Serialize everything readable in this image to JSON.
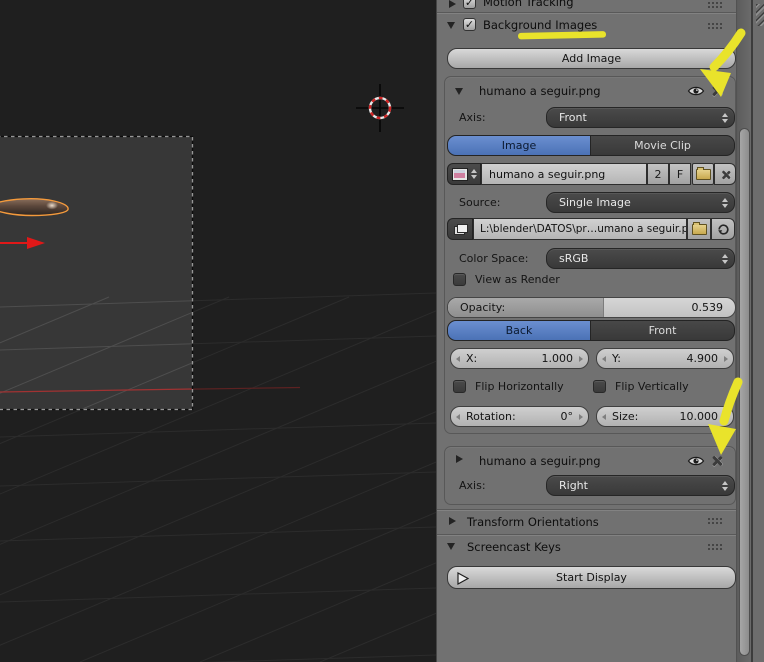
{
  "icons": {
    "checkmark": "✓"
  },
  "panel": {
    "motion_tracking": {
      "label": "Motion Tracking"
    },
    "background_images": {
      "label": "Background Images",
      "add_button": "Add Image"
    },
    "image1": {
      "title": "humano a seguir.png",
      "axis_label": "Axis:",
      "axis_value": "Front",
      "tab_image": "Image",
      "tab_movie_clip": "Movie Clip",
      "datablock_name": "humano a seguir.png",
      "users_count": "2",
      "fake_user": "F",
      "source_label": "Source:",
      "source_value": "Single Image",
      "filepath": "L:\\blender\\DATOS\\pr…umano a seguir.png",
      "color_space_label": "Color Space:",
      "color_space_value": "sRGB",
      "view_as_render_label": "View as Render",
      "opacity_label": "Opacity:",
      "opacity_value": "0.539",
      "back_label": "Back",
      "front_label": "Front",
      "x_label": "X:",
      "x_value": "1.000",
      "y_label": "Y:",
      "y_value": "4.900",
      "flip_h_label": "Flip Horizontally",
      "flip_v_label": "Flip Vertically",
      "rotation_label": "Rotation:",
      "rotation_value": "0°",
      "size_label": "Size:",
      "size_value": "10.000"
    },
    "image2": {
      "title": "humano a seguir.png",
      "axis_label": "Axis:",
      "axis_value": "Right"
    },
    "transform_orientations": {
      "label": "Transform Orientations"
    },
    "screencast_keys": {
      "label": "Screencast Keys",
      "start_button": "Start Display"
    }
  },
  "colors": {
    "accent_blue": "#5680c4",
    "annotation_yellow": "#e9e32b",
    "selection_orange": "#f49a3c",
    "axis_red": "#9d3030"
  }
}
